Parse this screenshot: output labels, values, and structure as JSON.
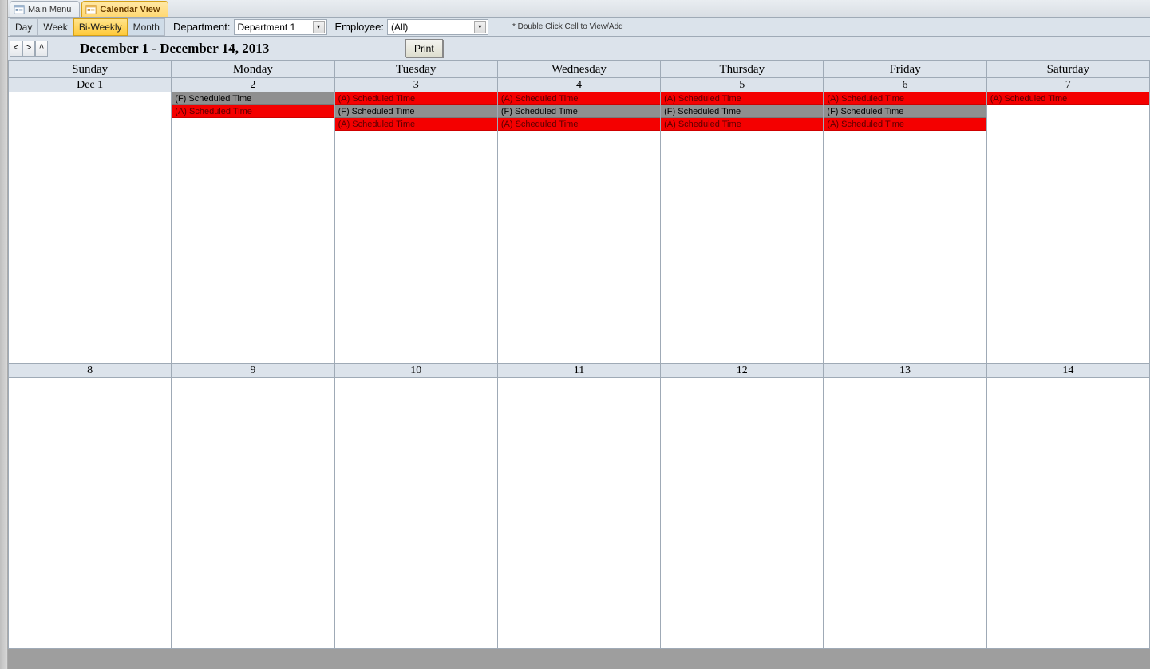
{
  "tabs": [
    {
      "label": "Main Menu",
      "active": false
    },
    {
      "label": "Calendar View",
      "active": true
    }
  ],
  "viewModes": {
    "day": "Day",
    "week": "Week",
    "biweekly": "Bi-Weekly",
    "month": "Month",
    "active": "biweekly"
  },
  "filters": {
    "departmentLabel": "Department:",
    "departmentValue": "Department 1",
    "employeeLabel": "Employee:",
    "employeeValue": "(All)"
  },
  "hint": "* Double Click Cell to View/Add",
  "nav": {
    "prev": "<",
    "next": ">",
    "up": "^"
  },
  "rangeTitle": "December 1 - December 14, 2013",
  "printLabel": "Print",
  "dayHeaders": [
    "Sunday",
    "Monday",
    "Tuesday",
    "Wednesday",
    "Thursday",
    "Friday",
    "Saturday"
  ],
  "weeks": [
    {
      "dates": [
        "Dec 1",
        "2",
        "3",
        "4",
        "5",
        "6",
        "7"
      ],
      "cells": [
        [],
        [
          {
            "text": "(F) Scheduled Time",
            "cls": "ev-gray"
          },
          {
            "text": "(A) Scheduled Time",
            "cls": "ev-red"
          }
        ],
        [
          {
            "text": "(A) Scheduled Time",
            "cls": "ev-red"
          },
          {
            "text": "(F) Scheduled Time",
            "cls": "ev-gray"
          },
          {
            "text": "(A) Scheduled Time",
            "cls": "ev-red"
          }
        ],
        [
          {
            "text": "(A) Scheduled Time",
            "cls": "ev-red"
          },
          {
            "text": "(F) Scheduled Time",
            "cls": "ev-gray"
          },
          {
            "text": "(A) Scheduled Time",
            "cls": "ev-red"
          }
        ],
        [
          {
            "text": "(A) Scheduled Time",
            "cls": "ev-red"
          },
          {
            "text": "(F) Scheduled Time",
            "cls": "ev-gray"
          },
          {
            "text": "(A) Scheduled Time",
            "cls": "ev-red"
          }
        ],
        [
          {
            "text": "(A) Scheduled Time",
            "cls": "ev-red"
          },
          {
            "text": "(F) Scheduled Time",
            "cls": "ev-gray"
          },
          {
            "text": "(A) Scheduled Time",
            "cls": "ev-red"
          }
        ],
        [
          {
            "text": "(A) Scheduled Time",
            "cls": "ev-red"
          }
        ]
      ]
    },
    {
      "dates": [
        "8",
        "9",
        "10",
        "11",
        "12",
        "13",
        "14"
      ],
      "cells": [
        [],
        [],
        [],
        [],
        [],
        [],
        []
      ]
    }
  ]
}
